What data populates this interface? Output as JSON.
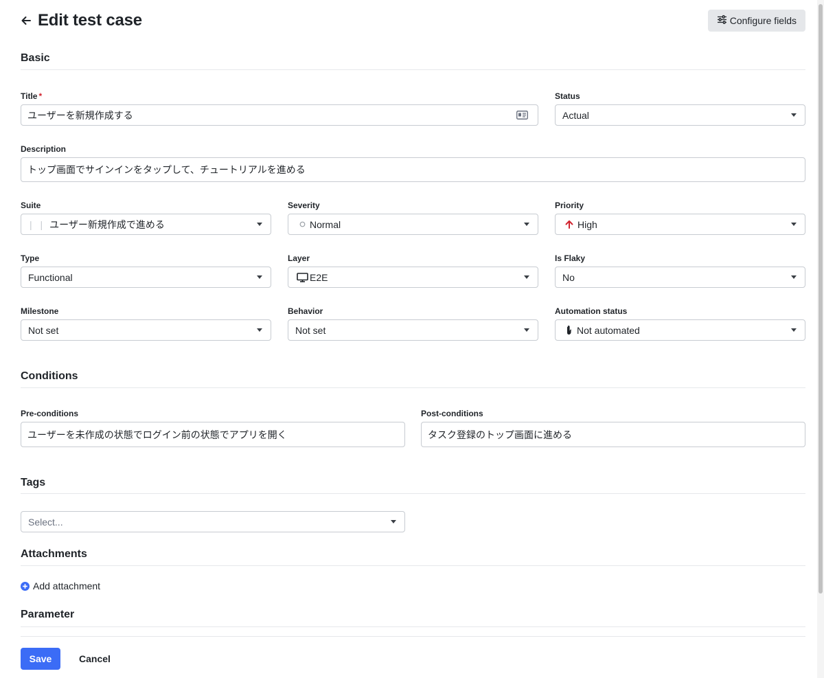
{
  "header": {
    "title": "Edit test case",
    "configure_label": "Configure fields"
  },
  "sections": {
    "basic": "Basic",
    "conditions": "Conditions",
    "tags": "Tags",
    "attachments": "Attachments",
    "parameter": "Parameter"
  },
  "fields": {
    "title": {
      "label": "Title",
      "required_mark": "*",
      "value": "ユーザーを新規作成する"
    },
    "status": {
      "label": "Status",
      "value": "Actual"
    },
    "description": {
      "label": "Description",
      "value": "トップ画面でサインインをタップして、チュートリアルを進める"
    },
    "suite": {
      "label": "Suite",
      "prefix": "| |",
      "value": "ユーザー新規作成で進める"
    },
    "severity": {
      "label": "Severity",
      "value": "Normal"
    },
    "priority": {
      "label": "Priority",
      "value": "High"
    },
    "type": {
      "label": "Type",
      "value": "Functional"
    },
    "layer": {
      "label": "Layer",
      "value": "E2E"
    },
    "is_flaky": {
      "label": "Is Flaky",
      "value": "No"
    },
    "milestone": {
      "label": "Milestone",
      "value": "Not set"
    },
    "behavior": {
      "label": "Behavior",
      "value": "Not set"
    },
    "automation_status": {
      "label": "Automation status",
      "value": "Not automated"
    },
    "pre_conditions": {
      "label": "Pre-conditions",
      "value": "ユーザーを未作成の状態でログイン前の状態でアプリを開く"
    },
    "post_conditions": {
      "label": "Post-conditions",
      "value": "タスク登録のトップ画面に進める"
    },
    "tags": {
      "placeholder": "Select..."
    }
  },
  "attachments": {
    "add_label": "Add attachment"
  },
  "footer": {
    "save_label": "Save",
    "cancel_label": "Cancel"
  },
  "icons": {
    "back": "arrow-left-icon",
    "configure": "sliders-icon",
    "title_field": "id-card-icon",
    "severity": "circle-icon",
    "priority": "arrow-up-icon",
    "layer": "monitor-icon",
    "automation": "hand-icon",
    "add_attachment": "plus-circle-icon"
  },
  "colors": {
    "primary": "#3b6cf6",
    "priority_high": "#d1242f",
    "required": "#d1242f"
  }
}
